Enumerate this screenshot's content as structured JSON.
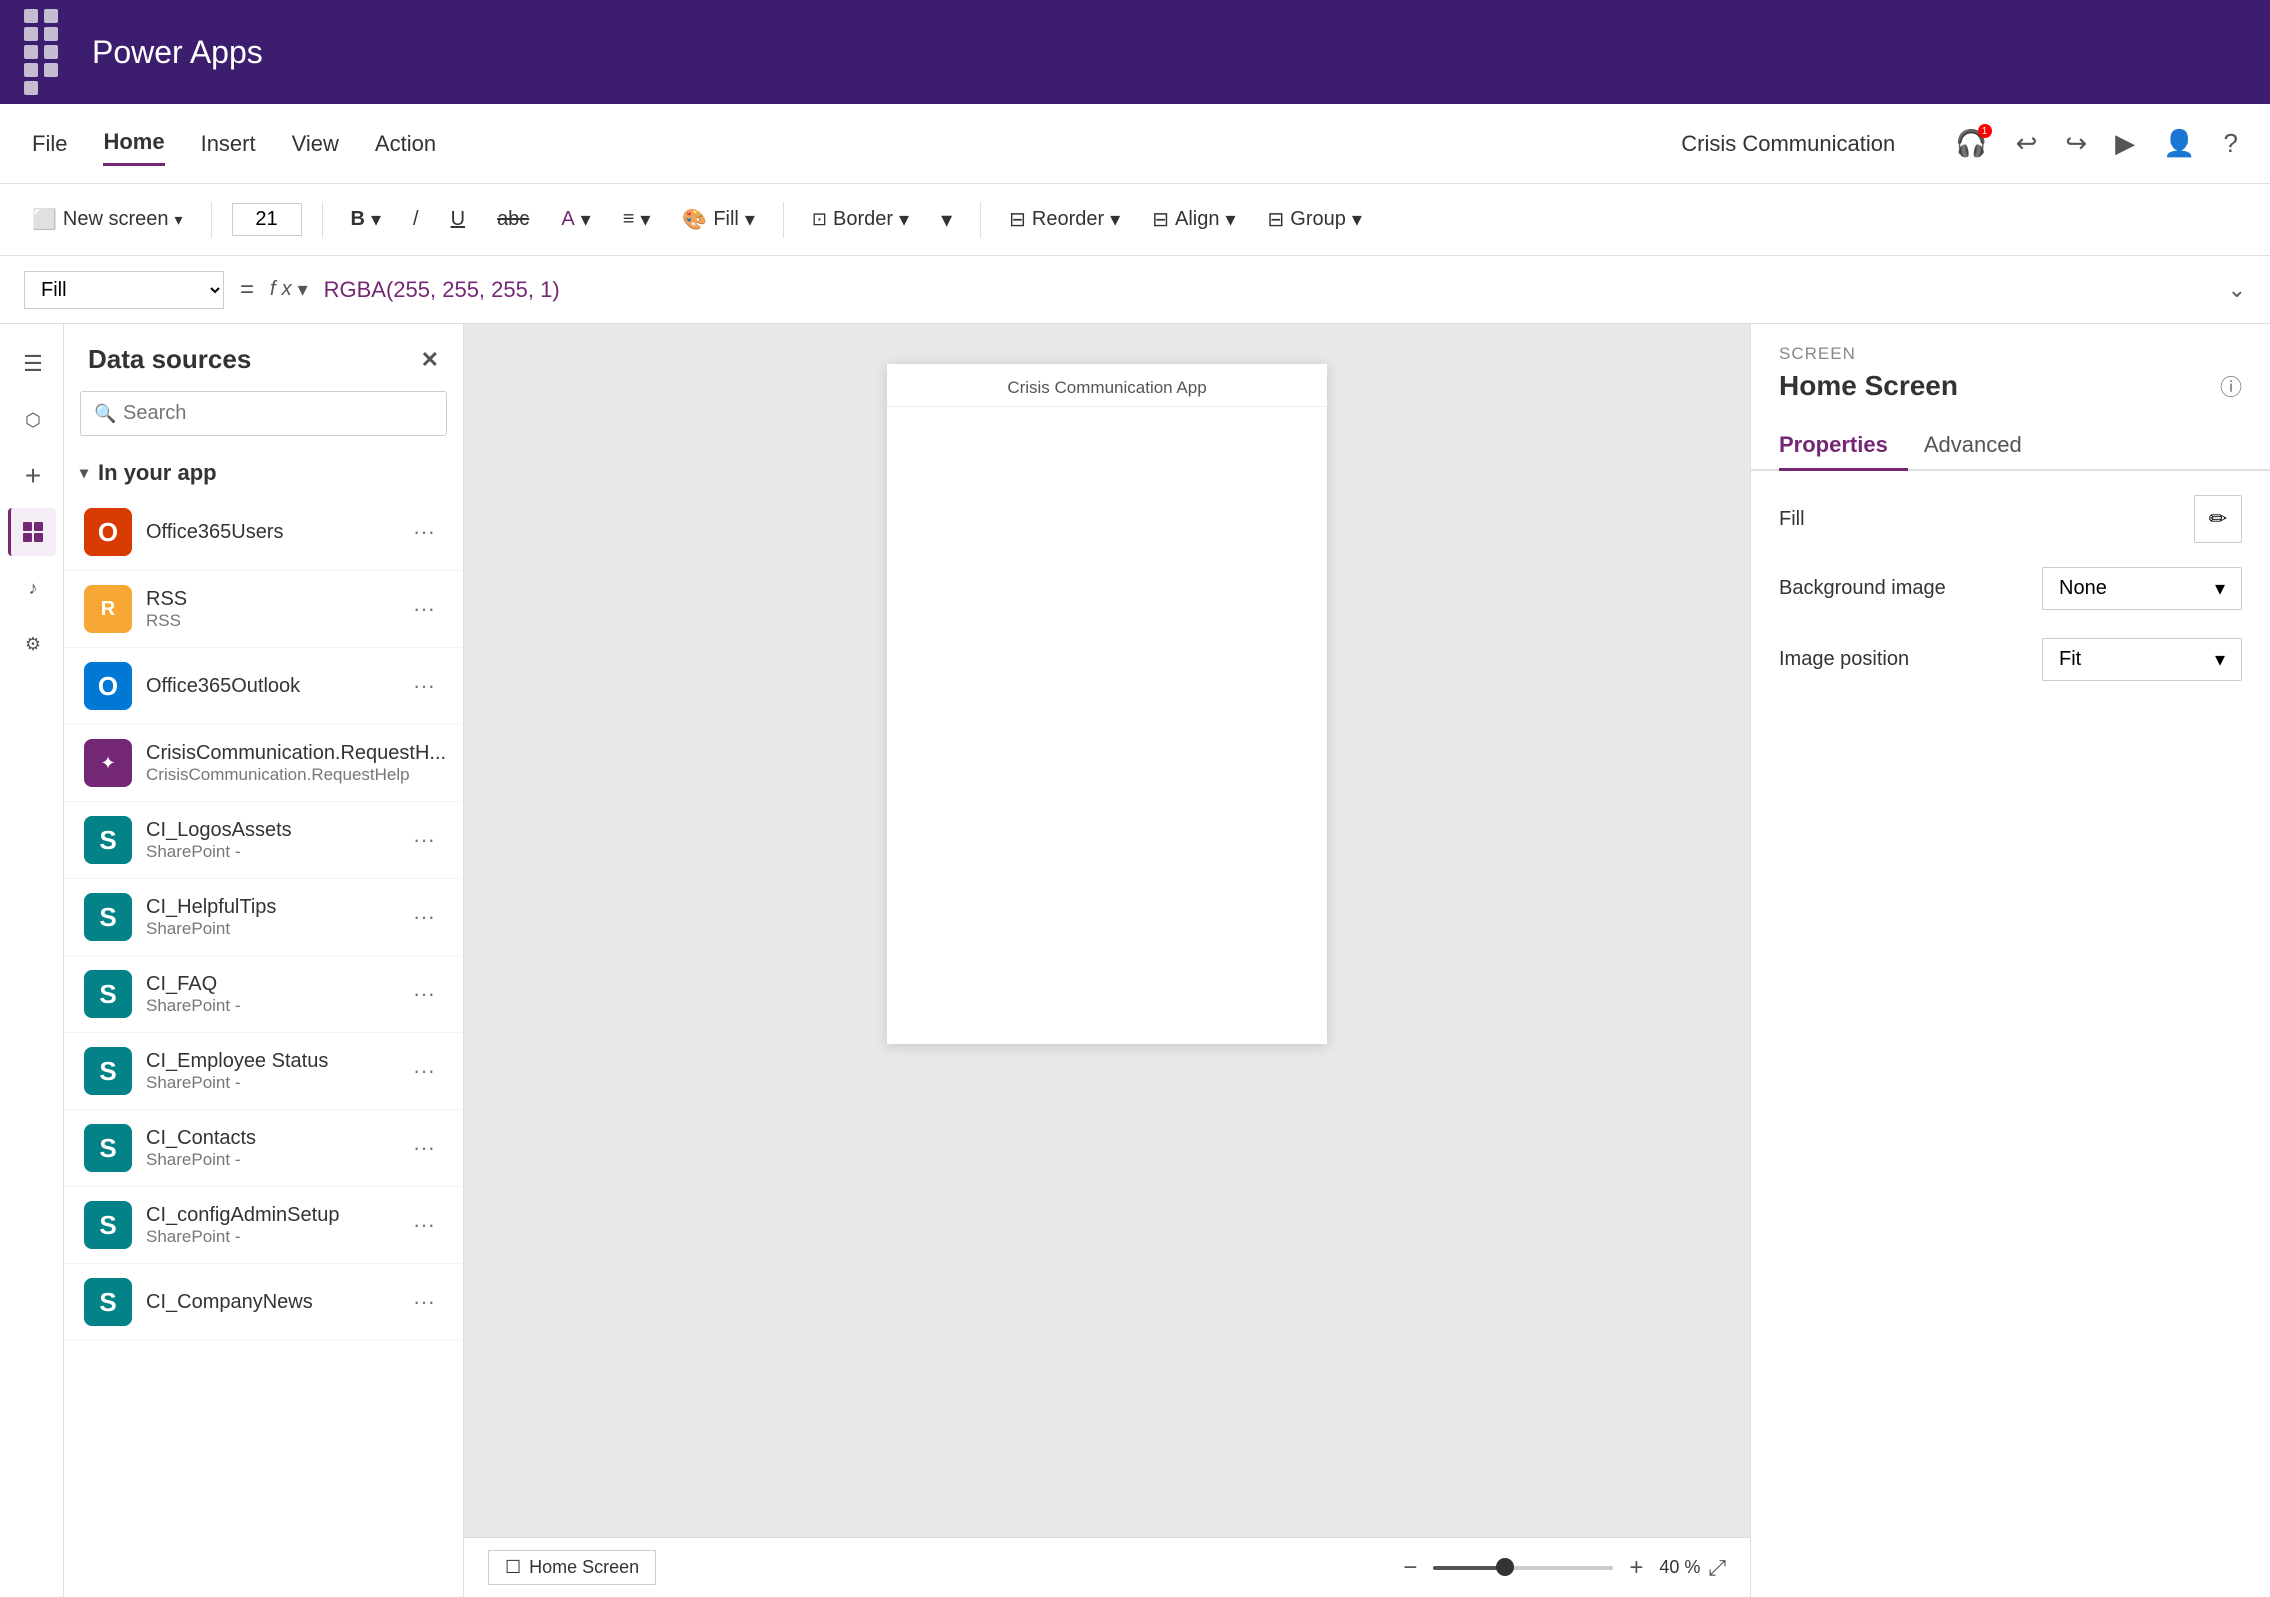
{
  "topbar": {
    "title": "Power Apps",
    "app_name": "Crisis Communication"
  },
  "menubar": {
    "items": [
      {
        "label": "File",
        "active": false
      },
      {
        "label": "Home",
        "active": true
      },
      {
        "label": "Insert",
        "active": false
      },
      {
        "label": "View",
        "active": false
      },
      {
        "label": "Action",
        "active": false
      }
    ]
  },
  "toolbar": {
    "new_screen": "New screen",
    "font_size": "21",
    "fill": "Fill",
    "border": "Border",
    "reorder": "Reorder",
    "align": "Align",
    "group": "Group"
  },
  "formula_bar": {
    "property": "Fill",
    "formula": "RGBA(255, 255, 255, 1)"
  },
  "panel": {
    "title": "Data sources",
    "search_placeholder": "Search",
    "section_in_your_app": "In your app",
    "items": [
      {
        "name": "Office365Users",
        "sub": "",
        "icon_type": "o365users",
        "icon_char": "O"
      },
      {
        "name": "RSS",
        "sub": "RSS",
        "icon_type": "rss",
        "icon_char": "R"
      },
      {
        "name": "Office365Outlook",
        "sub": "",
        "icon_type": "outlook",
        "icon_char": "O"
      },
      {
        "name": "CrisisCommunication.RequestH...",
        "sub": "CrisisCommunication.RequestHelp",
        "icon_type": "crisis",
        "icon_char": "✦"
      },
      {
        "name": "CI_LogosAssets",
        "sub": "SharePoint -",
        "icon_type": "sharepoint",
        "icon_char": "S"
      },
      {
        "name": "CI_HelpfulTips",
        "sub": "SharePoint",
        "icon_type": "sharepoint",
        "icon_char": "S"
      },
      {
        "name": "CI_FAQ",
        "sub": "SharePoint -",
        "icon_type": "sharepoint",
        "icon_char": "S"
      },
      {
        "name": "CI_Employee Status",
        "sub": "SharePoint -",
        "icon_type": "sharepoint",
        "icon_char": "S"
      },
      {
        "name": "CI_Contacts",
        "sub": "SharePoint -",
        "icon_type": "sharepoint",
        "icon_char": "S"
      },
      {
        "name": "CI_configAdminSetup",
        "sub": "SharePoint -",
        "icon_type": "sharepoint",
        "icon_char": "S"
      },
      {
        "name": "CI_CompanyNews",
        "sub": "",
        "icon_type": "sharepoint",
        "icon_char": "S"
      }
    ]
  },
  "canvas": {
    "screen_label": "Crisis Communication App",
    "screen_name": "Home Screen",
    "zoom": "40",
    "zoom_unit": "%"
  },
  "right_panel": {
    "screen_label": "SCREEN",
    "title": "Home Screen",
    "tabs": [
      {
        "label": "Properties",
        "active": true
      },
      {
        "label": "Advanced",
        "active": false
      }
    ],
    "fill_label": "Fill",
    "bg_image_label": "Background image",
    "bg_image_value": "None",
    "image_position_label": "Image position",
    "image_position_value": "Fit"
  },
  "left_sidebar": {
    "icons": [
      {
        "name": "hamburger-icon",
        "char": "☰",
        "active": false
      },
      {
        "name": "layers-icon",
        "char": "⬡",
        "active": false
      },
      {
        "name": "add-icon",
        "char": "+",
        "active": false
      },
      {
        "name": "data-icon",
        "char": "⊞",
        "active": true
      },
      {
        "name": "media-icon",
        "char": "♪",
        "active": false
      },
      {
        "name": "controls-icon",
        "char": "⊞",
        "active": false
      }
    ]
  }
}
